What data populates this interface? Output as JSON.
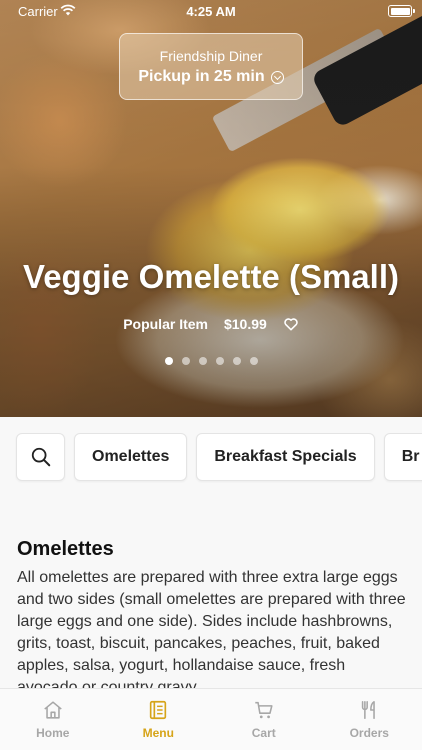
{
  "status_bar": {
    "carrier": "Carrier",
    "time": "4:25 AM"
  },
  "pickup": {
    "restaurant": "Friendship Diner",
    "time_label": "Pickup in 25 min"
  },
  "hero": {
    "title": "Veggie Omelette (Small)",
    "badge": "Popular Item",
    "price": "$10.99",
    "slide_count": 6,
    "active_slide": 1
  },
  "categories": [
    "Omelettes",
    "Breakfast Specials",
    "Br"
  ],
  "section": {
    "title": "Omelettes",
    "description": "All omelettes are prepared with three extra large eggs and two sides (small omelettes are prepared with three large eggs and one side). Sides include hashbrowns, grits, toast, biscuit, pancakes, peaches, fruit, baked apples, salsa, yogurt, hollandaise sauce, fresh avocado or country gravy."
  },
  "tabs": [
    {
      "label": "Home",
      "icon": "home-icon",
      "active": false
    },
    {
      "label": "Menu",
      "icon": "menu-icon",
      "active": true
    },
    {
      "label": "Cart",
      "icon": "cart-icon",
      "active": false
    },
    {
      "label": "Orders",
      "icon": "fork-knife-icon",
      "active": false
    }
  ],
  "colors": {
    "accent": "#d6a419",
    "inactive_tab": "#a7a7a7"
  }
}
